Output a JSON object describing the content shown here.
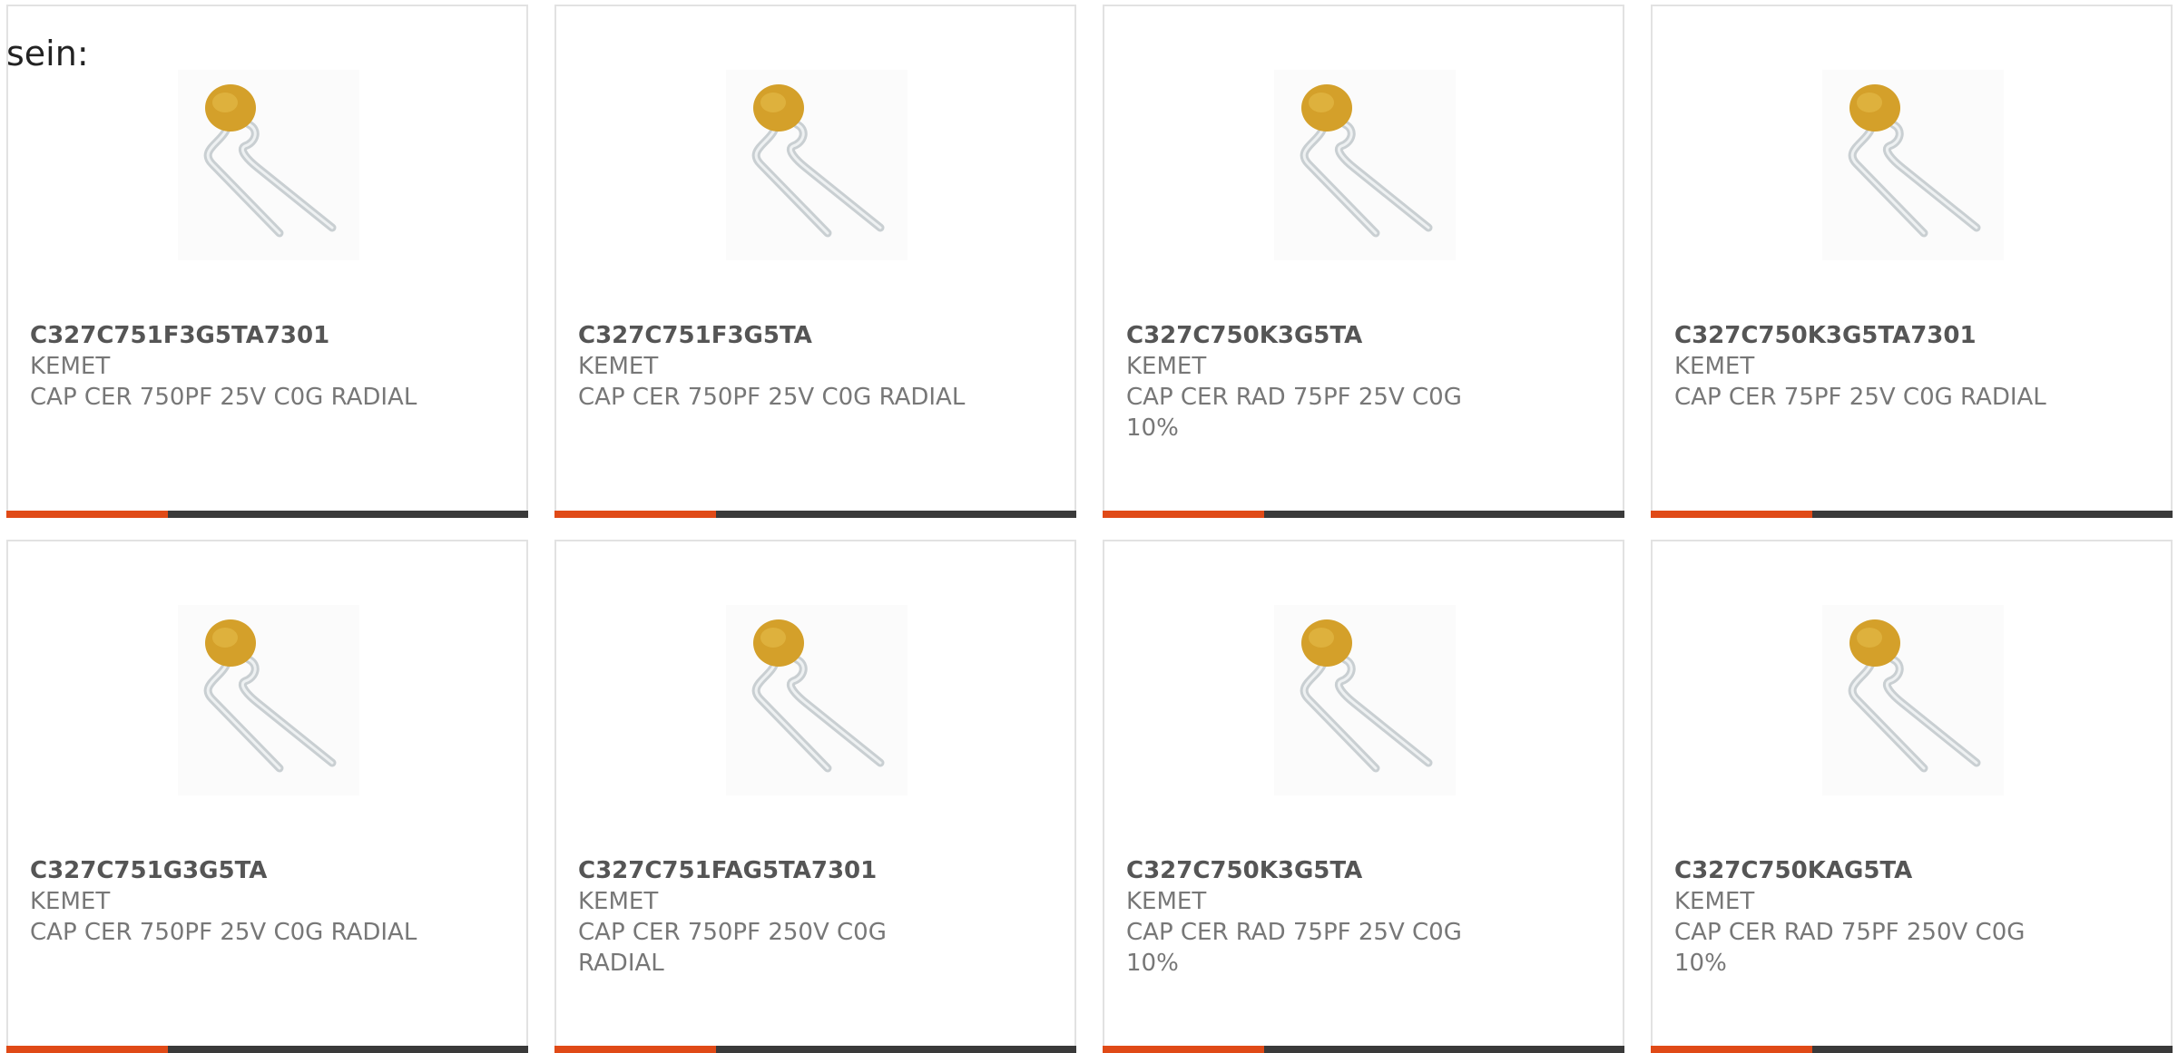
{
  "intro_text": "sein:",
  "accent_color": "#e04a17",
  "bar_color": "#3a3a3a",
  "bar_accent_fraction": 0.31,
  "products": [
    {
      "part_number": "C327C751F3G5TA7301",
      "manufacturer": "KEMET",
      "description": "CAP CER 750PF 25V C0G RADIAL",
      "image_icon": "radial-capacitor-icon"
    },
    {
      "part_number": "C327C751F3G5TA",
      "manufacturer": "KEMET",
      "description": "CAP CER 750PF 25V C0G RADIAL",
      "image_icon": "radial-capacitor-icon"
    },
    {
      "part_number": "C327C750K3G5TA",
      "manufacturer": "KEMET",
      "description": "CAP CER RAD 75PF 25V C0G 10%",
      "image_icon": "radial-capacitor-icon"
    },
    {
      "part_number": "C327C750K3G5TA7301",
      "manufacturer": "KEMET",
      "description": "CAP CER 75PF 25V C0G RADIAL",
      "image_icon": "radial-capacitor-icon"
    },
    {
      "part_number": "C327C751G3G5TA",
      "manufacturer": "KEMET",
      "description": "CAP CER 750PF 25V C0G RADIAL",
      "image_icon": "radial-capacitor-icon"
    },
    {
      "part_number": "C327C751FAG5TA7301",
      "manufacturer": "KEMET",
      "description": "CAP CER 750PF 250V C0G RADIAL",
      "image_icon": "radial-capacitor-icon"
    },
    {
      "part_number": "C327C750K3G5TA",
      "manufacturer": "KEMET",
      "description": "CAP CER RAD 75PF 25V C0G 10%",
      "image_icon": "radial-capacitor-icon"
    },
    {
      "part_number": "C327C750KAG5TA",
      "manufacturer": "KEMET",
      "description": "CAP CER RAD 75PF 250V C0G 10%",
      "image_icon": "radial-capacitor-icon"
    }
  ]
}
